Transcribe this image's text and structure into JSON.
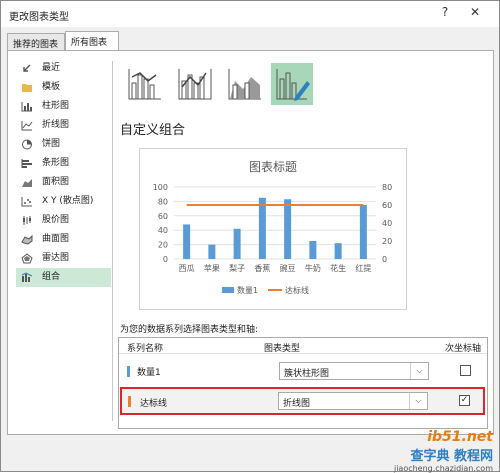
{
  "window": {
    "title": "更改图表类型",
    "help": "?",
    "close": "✕"
  },
  "tabs": [
    {
      "label": "推荐的图表"
    },
    {
      "label": "所有图表"
    }
  ],
  "sidebar": {
    "items": [
      {
        "label": "最近",
        "icon": "recent-icon"
      },
      {
        "label": "模板",
        "icon": "template-folder-icon"
      },
      {
        "label": "柱形图",
        "icon": "column-chart-icon"
      },
      {
        "label": "折线图",
        "icon": "line-chart-icon"
      },
      {
        "label": "饼图",
        "icon": "pie-chart-icon"
      },
      {
        "label": "条形图",
        "icon": "bar-chart-icon"
      },
      {
        "label": "面积图",
        "icon": "area-chart-icon"
      },
      {
        "label": "X Y (散点图)",
        "icon": "scatter-chart-icon"
      },
      {
        "label": "股价图",
        "icon": "stock-chart-icon"
      },
      {
        "label": "曲面图",
        "icon": "surface-chart-icon"
      },
      {
        "label": "雷达图",
        "icon": "radar-chart-icon"
      },
      {
        "label": "组合",
        "icon": "combo-chart-icon",
        "selected": true
      }
    ]
  },
  "section_title": "自定义组合",
  "chart_data": {
    "type": "bar",
    "title": "图表标题",
    "categories": [
      "西瓜",
      "苹果",
      "梨子",
      "香蕉",
      "豌豆",
      "牛奶",
      "花生",
      "红提"
    ],
    "series": [
      {
        "name": "数量1",
        "type": "bar",
        "values": [
          48,
          20,
          42,
          85,
          83,
          25,
          22,
          75
        ],
        "color": "#5b9bd5"
      },
      {
        "name": "达标线",
        "type": "line",
        "values": [
          60,
          60,
          60,
          60,
          60,
          60,
          60,
          60
        ],
        "color": "#ed7d31"
      }
    ],
    "ylim": [
      0,
      100
    ],
    "yticks": [
      "0",
      "20",
      "40",
      "60",
      "80",
      "100"
    ],
    "y2lim": [
      0,
      80
    ],
    "y2ticks": [
      "0",
      "20",
      "40",
      "60",
      "80"
    ],
    "legend_position": "bottom"
  },
  "series_section": {
    "label": "为您的数据系列选择图表类型和轴:",
    "headers": {
      "name": "系列名称",
      "type": "图表类型",
      "secondary": "次坐标轴"
    },
    "rows": [
      {
        "name": "数量1",
        "type": "簇状柱形图",
        "secondary": false,
        "color": "#5b9bd5"
      },
      {
        "name": "达标线",
        "type": "折线图",
        "secondary": true,
        "color": "#ed7d31"
      }
    ]
  },
  "watermark": {
    "line1": "ib51.net",
    "line2": "查字典 教程网",
    "line3": "jiaocheng.chazidian.com"
  }
}
